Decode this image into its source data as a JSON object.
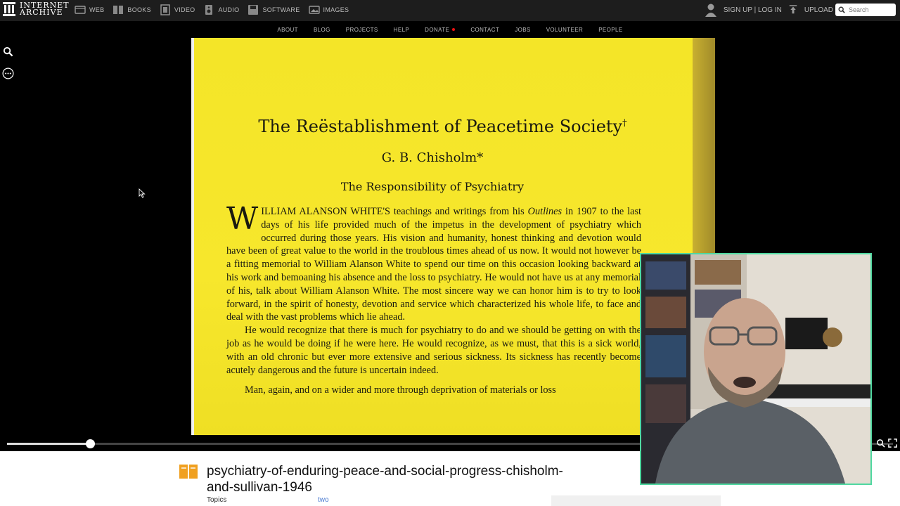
{
  "header": {
    "logo_text_line1": "INTERNET",
    "logo_text_line2": "ARCHIVE",
    "media_items": [
      {
        "label": "WEB",
        "icon": "web-icon"
      },
      {
        "label": "BOOKS",
        "icon": "books-icon"
      },
      {
        "label": "VIDEO",
        "icon": "video-icon"
      },
      {
        "label": "AUDIO",
        "icon": "audio-icon"
      },
      {
        "label": "SOFTWARE",
        "icon": "software-icon"
      },
      {
        "label": "IMAGES",
        "icon": "images-icon"
      }
    ],
    "signup_label": "SIGN UP | LOG IN",
    "upload_label": "UPLOAD",
    "search_placeholder": "Search"
  },
  "subnav": {
    "items": [
      "ABOUT",
      "BLOG",
      "PROJECTS",
      "HELP",
      "DONATE",
      "CONTACT",
      "JOBS",
      "VOLUNTEER",
      "PEOPLE"
    ]
  },
  "document": {
    "title": "The Reëstablishment of Peacetime Society",
    "title_mark": "†",
    "author": "G. B. Chisholm*",
    "section": "The Responsibility of Psychiatry",
    "dropcap": "W",
    "paragraph1_a": "ILLIAM ALANSON WHITE'S teachings and writings from his ",
    "paragraph1_italic": "Outlines",
    "paragraph1_b": " in 1907 to the last days of his life provided much of the impetus in the development of psychiatry which occurred during those years. His vision and humanity, honest thinking and devotion would have been of great value to the world in the troublous times ahead of us now. It would not however be a fitting memorial to William Alanson White to spend our time on this occasion looking backward at his work and bemoaning his absence and the loss to psychiatry. He would not have us at any memorial of his, talk about William Alanson White. The most sincere way we can honor him is to try to look forward, in the spirit of honesty, devotion and service which characterized his whole life, to face and deal with the vast problems which lie ahead.",
    "paragraph2": "He would recognize that there is much for psychiatry to do and we should be getting on with the job as he would be doing if he were here. He would recognize, as we must, that this is a sick world, with an old chronic but ever more extensive and serious sickness. Its sickness has recently become acutely dangerous and the future is uncertain indeed.",
    "paragraph3": "Man, again, and on a wider and more   through deprivation of materials or loss"
  },
  "viewer": {
    "progress": 0.094
  },
  "item": {
    "title": "psychiatry-of-enduring-peace-and-social-progress-chisholm-and-sullivan-1946",
    "topics_label": "Topics",
    "topics_value": "two"
  },
  "colors": {
    "page": "#f4e528",
    "webcam_border": "#4fd8a0",
    "item_icon": "#f0a020"
  }
}
